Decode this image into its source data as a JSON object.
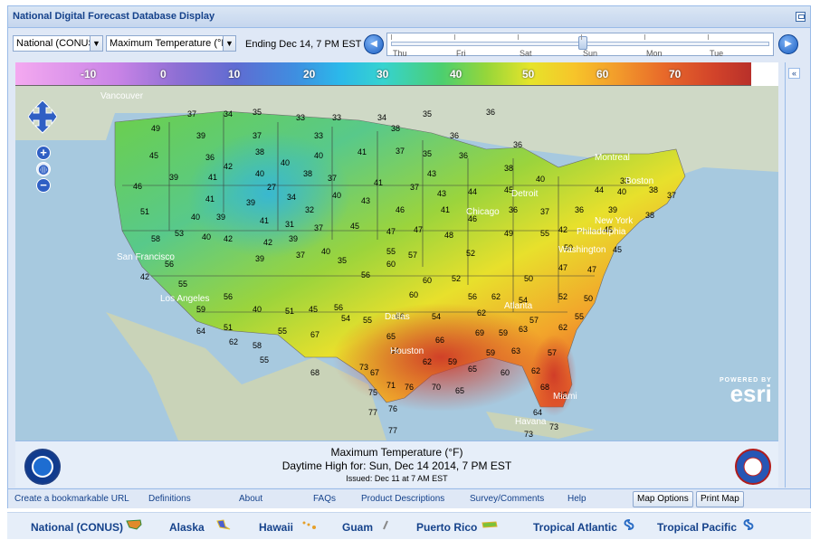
{
  "app": {
    "title": "National Digital Forecast Database Display"
  },
  "toolbar": {
    "region_select": "National (CONUS",
    "element_select": "Maximum Temperature (°F",
    "ending_label": "Ending Dec 14,   7 PM EST",
    "timeline_days": [
      "Thu",
      "Fri",
      "Sat",
      "Sun",
      "Mon",
      "Tue"
    ]
  },
  "legend": {
    "labels": [
      "-10",
      "0",
      "10",
      "20",
      "30",
      "40",
      "50",
      "60",
      "70"
    ]
  },
  "map": {
    "labels": [
      "Vancouver",
      "Montreal",
      "Chicago",
      "Detroit",
      "Boston",
      "New York",
      "Philadelphia",
      "Washington",
      "San Francisco",
      "Los Angeles",
      "Dallas",
      "Atlanta",
      "Houston",
      "Miami",
      "Havana"
    ],
    "temps": [
      "49",
      "37",
      "34",
      "35",
      "33",
      "33",
      "34",
      "35",
      "36",
      "36",
      "39",
      "37",
      "33",
      "38",
      "36",
      "45",
      "36",
      "42",
      "38",
      "40",
      "40",
      "41",
      "37",
      "35",
      "36",
      "38",
      "40",
      "43",
      "46",
      "39",
      "41",
      "40",
      "27",
      "38",
      "37",
      "41",
      "37",
      "43",
      "44",
      "45",
      "44",
      "40",
      "38",
      "37",
      "33",
      "40",
      "43",
      "41",
      "39",
      "34",
      "32",
      "38",
      "51",
      "40",
      "39",
      "41",
      "31",
      "46",
      "41",
      "36",
      "37",
      "36",
      "39",
      "46",
      "58",
      "53",
      "40",
      "42",
      "42",
      "39",
      "37",
      "45",
      "47",
      "47",
      "48",
      "42",
      "45",
      "49",
      "55",
      "52",
      "50",
      "45",
      "56",
      "55",
      "39",
      "37",
      "40",
      "35",
      "55",
      "56",
      "60",
      "57",
      "52",
      "47",
      "47",
      "50",
      "42",
      "60",
      "56",
      "60",
      "56",
      "62",
      "54",
      "52",
      "50",
      "59",
      "56",
      "40",
      "51",
      "45",
      "62",
      "66",
      "54",
      "55",
      "54",
      "55",
      "57",
      "62",
      "64",
      "51",
      "55",
      "67",
      "65",
      "66",
      "69",
      "59",
      "63",
      "59",
      "63",
      "57",
      "55",
      "62",
      "58",
      "64",
      "62",
      "59",
      "68",
      "73",
      "67",
      "62",
      "65",
      "60",
      "71",
      "70",
      "76",
      "75",
      "65",
      "68",
      "65",
      "77",
      "76",
      "77",
      "73",
      "64",
      "73"
    ],
    "attribution_top": "POWERED BY",
    "attribution_name": "esri"
  },
  "caption": {
    "line1": "Maximum Temperature (°F)",
    "line2": "Daytime High for: Sun, Dec 14 2014,   7 PM EST",
    "line3": "Issued: Dec 11 at 7 AM EST"
  },
  "links": {
    "bookmark": "Create a bookmarkable URL",
    "definitions": "Definitions",
    "about": "About",
    "faqs": "FAQs",
    "product_descriptions": "Product Descriptions",
    "survey": "Survey/Comments",
    "help": "Help",
    "map_options": "Map Options",
    "print_map": "Print Map"
  },
  "regions": [
    "National (CONUS)",
    "Alaska",
    "Hawaii",
    "Guam",
    "Puerto Rico",
    "Tropical Atlantic",
    "Tropical Pacific"
  ]
}
